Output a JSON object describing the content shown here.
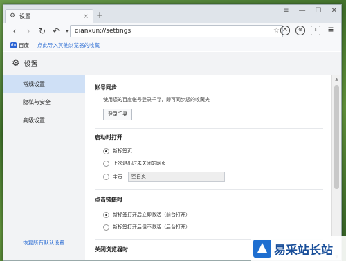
{
  "tab": {
    "title": "设置",
    "close_label": "×"
  },
  "newtab_label": "+",
  "window_buttons": [
    "≡",
    "—",
    "☐",
    "✕"
  ],
  "nav": {
    "back": "‹",
    "forward": "›",
    "reload": "↻",
    "undo": "↶",
    "undo_arrow": "▾",
    "address": "qianxun://settings",
    "star": "☆",
    "tools": [
      "A",
      "⊘",
      "⇩",
      "≡"
    ]
  },
  "bookmarks": {
    "baidu_icon": "du",
    "baidu_label": "百度",
    "import_label": "点此导入其他浏览器的收藏"
  },
  "header": {
    "title": "设置"
  },
  "sidebar": {
    "items": [
      {
        "label": "常规设置",
        "active": true
      },
      {
        "label": "隐私与安全",
        "active": false
      },
      {
        "label": "高级设置",
        "active": false
      }
    ],
    "restore_label": "恢复所有默认设置"
  },
  "sections": {
    "sync": {
      "title": "帐号同步",
      "desc": "使用您的百度帐号登录千寻，即可同步您的收藏夹",
      "login_button": "登录千寻"
    },
    "startup": {
      "title": "启动时打开",
      "options": [
        {
          "label": "新标签页",
          "checked": true
        },
        {
          "label": "上次退出时未关闭的网页",
          "checked": false
        },
        {
          "label": "主页",
          "checked": false
        }
      ],
      "home_value": "空白页"
    },
    "links": {
      "title": "点击链接时",
      "options": [
        {
          "label": "新标签打开后立即激活（前台打开）",
          "checked": true
        },
        {
          "label": "新标签打开后但不激活（后台打开）",
          "checked": false
        }
      ]
    },
    "close": {
      "title": "关闭浏览器时"
    }
  },
  "watermark": {
    "text": "易采站长站",
    "url": "jb51.net"
  },
  "colors": {
    "accent": "#2f6fd4",
    "active_bg": "#cfe0f6"
  }
}
